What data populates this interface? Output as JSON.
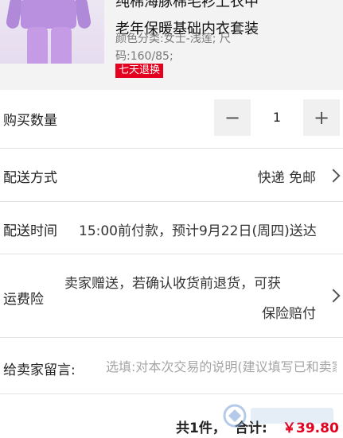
{
  "product": {
    "title_line1": "纯棉海豚棉毛衫上衣中",
    "title_line2": "老年保暖基础内衣套装",
    "spec": "颜色分类:女士-浅莲; 尺码:160/85;",
    "badge": "七天退换"
  },
  "quantity": {
    "label": "购买数量",
    "value": "1",
    "minus": "−",
    "plus": "+"
  },
  "shipping": {
    "label": "配送方式",
    "value": "快递 免邮"
  },
  "delivery_time": {
    "label": "配送时间",
    "value": "15:00前付款，预计9月22日(周四)送达"
  },
  "insurance": {
    "label": "运费险",
    "value_line1": "卖家赠送，若确认收货前退货，可获",
    "value_line2": "保险赔付"
  },
  "message": {
    "label": "给卖家留言:",
    "placeholder": "选填:对本次交易的说明(建议填写已和卖家协商一致的内容)"
  },
  "total": {
    "count": "共1件，",
    "sum_label": "合计:",
    "price": "￥39.80"
  },
  "colors": {
    "accent": "#e4001f",
    "row_border": "#e2e2e2",
    "product_bg": "#f3f3f3"
  }
}
